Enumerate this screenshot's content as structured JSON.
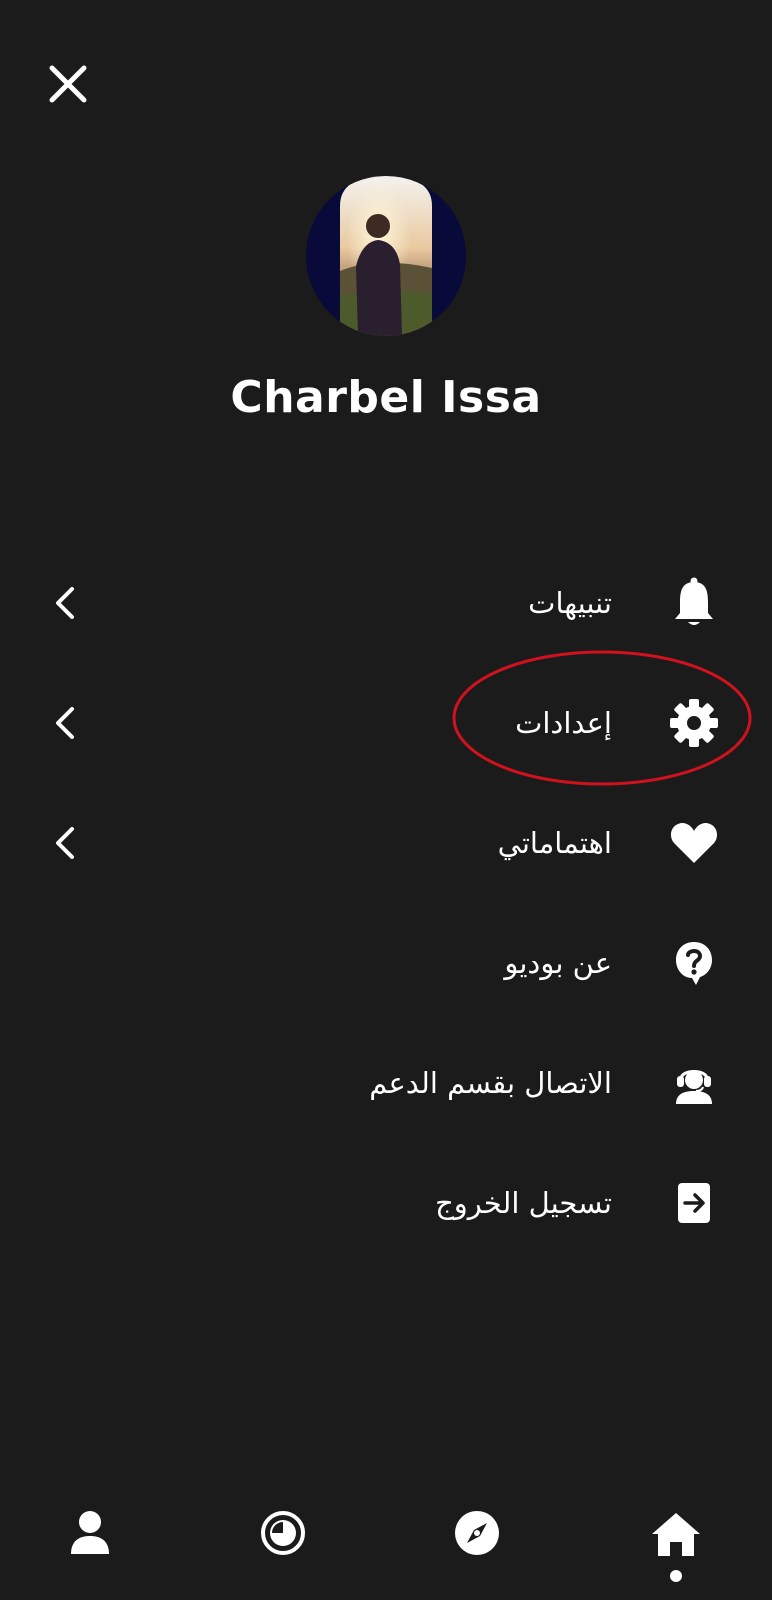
{
  "header": {
    "close_icon": "close-icon"
  },
  "profile": {
    "name": "Charbel Issa",
    "avatar_bg": "#080a3a"
  },
  "menu": {
    "items": [
      {
        "label": "تنبيهات",
        "icon": "bell-icon",
        "has_chevron": true
      },
      {
        "label": "إعدادات",
        "icon": "gear-icon",
        "has_chevron": true,
        "highlighted": true
      },
      {
        "label": "اهتماماتي",
        "icon": "heart-icon",
        "has_chevron": true
      },
      {
        "label": "عن بوديو",
        "icon": "question-bubble-icon",
        "has_chevron": false
      },
      {
        "label": "الاتصال بقسم الدعم",
        "icon": "support-agent-icon",
        "has_chevron": false
      },
      {
        "label": "تسجيل الخروج",
        "icon": "logout-icon",
        "has_chevron": false
      }
    ],
    "highlight_color": "#d0121e"
  },
  "bottom_nav": {
    "items": [
      {
        "icon": "user-icon"
      },
      {
        "icon": "history-icon"
      },
      {
        "icon": "compass-icon"
      },
      {
        "icon": "home-icon",
        "active": true
      }
    ]
  },
  "colors": {
    "background": "#1b1b1b",
    "foreground": "#ffffff"
  }
}
